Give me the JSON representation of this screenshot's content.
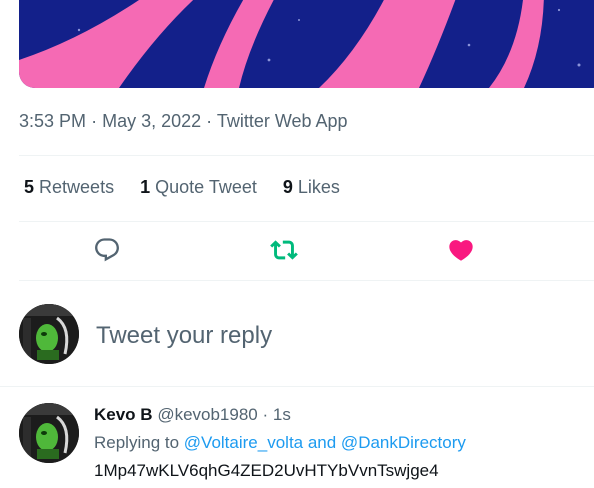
{
  "tweet": {
    "time": "3:53 PM",
    "date": "May 3, 2022",
    "source": "Twitter Web App",
    "sep": "·"
  },
  "stats": {
    "retweets_count": "5",
    "retweets_label": "Retweets",
    "quotes_count": "1",
    "quotes_label": "Quote Tweet",
    "likes_count": "9",
    "likes_label": "Likes"
  },
  "actions": {
    "reply_icon": "reply-icon",
    "retweet_icon": "retweet-icon",
    "like_icon": "heart-icon"
  },
  "composer": {
    "placeholder": "Tweet your reply"
  },
  "reply": {
    "name": "Kevo B",
    "handle": "@kevob1980",
    "sep": "·",
    "time": "1s",
    "replying_prefix": "Replying to",
    "mentions": "@Voltaire_volta and @DankDirectory",
    "text": "1Mp47wKLV6qhG4ZED2UvHTYbVvnTswjge4"
  },
  "colors": {
    "media_background": "#13208a",
    "media_accent": "#f56ab4",
    "retweet_active": "#00ba7c",
    "like_active": "#f91880",
    "link": "#1d9bf0"
  }
}
